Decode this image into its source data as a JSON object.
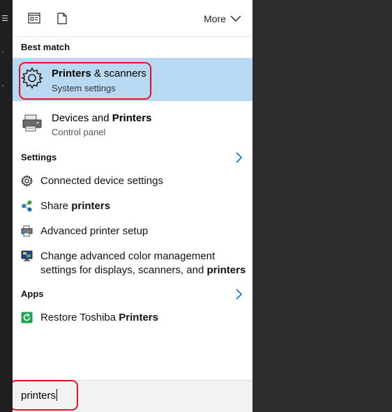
{
  "topbar": {
    "more_label": "More",
    "icon_left": "document-view-icon",
    "icon_right": "document-icon"
  },
  "best_match": {
    "header": "Best match",
    "top_result": {
      "title_bold": "Printers",
      "title_rest": " & scanners",
      "subtitle": "System settings",
      "icon": "gear-icon"
    },
    "second_result": {
      "title_plain": "Devices and ",
      "title_bold": "Printers",
      "subtitle": "Control panel",
      "icon": "printer-devices-icon"
    }
  },
  "settings": {
    "header": "Settings",
    "items": [
      {
        "plain": "Connected device settings",
        "bold": "",
        "icon": "gear-small-icon"
      },
      {
        "plain": "Share ",
        "bold": "printers",
        "icon": "share-icon"
      },
      {
        "plain": "Advanced printer setup",
        "bold": "",
        "icon": "printer-setup-icon"
      },
      {
        "line1": "Change advanced color management",
        "line2_plain": "settings for displays, scanners, and ",
        "line2_bold": "printers",
        "icon": "monitor-color-icon"
      }
    ]
  },
  "apps": {
    "header": "Apps",
    "items": [
      {
        "plain": "Restore Toshiba ",
        "bold": "Printers",
        "icon": "restore-icon"
      }
    ]
  },
  "search": {
    "value": "printers"
  },
  "colors": {
    "highlight": "#b9d9f2",
    "annotation": "#e81123",
    "accent": "#0078d7"
  }
}
